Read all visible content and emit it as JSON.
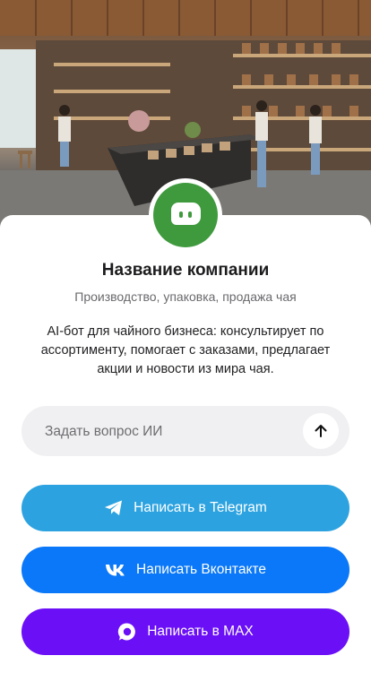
{
  "colors": {
    "avatar_bg": "#3f9a3e",
    "telegram": "#2ca3e0",
    "vk": "#0a78f8",
    "max": "#6b0ff7",
    "input_bg": "#f0f0f2"
  },
  "hero": {
    "image": "tea-shop-interior-photo"
  },
  "company": {
    "avatar_icon": "chat-bot-icon",
    "name": "Название компании",
    "tagline": "Производство, упаковка, продажа чая",
    "description": "AI-бот для чайного бизнеса: консультирует по ассортименту, помогает с заказами, предлагает акции и новости из мира чая."
  },
  "ask": {
    "placeholder": "Задать вопрос ИИ",
    "send_icon": "arrow-up-icon"
  },
  "buttons": [
    {
      "label": "Написать в Telegram",
      "icon": "telegram-icon"
    },
    {
      "label": "Написать Вконтакте",
      "icon": "vk-icon"
    },
    {
      "label": "Написать в MAX",
      "icon": "max-icon"
    }
  ]
}
